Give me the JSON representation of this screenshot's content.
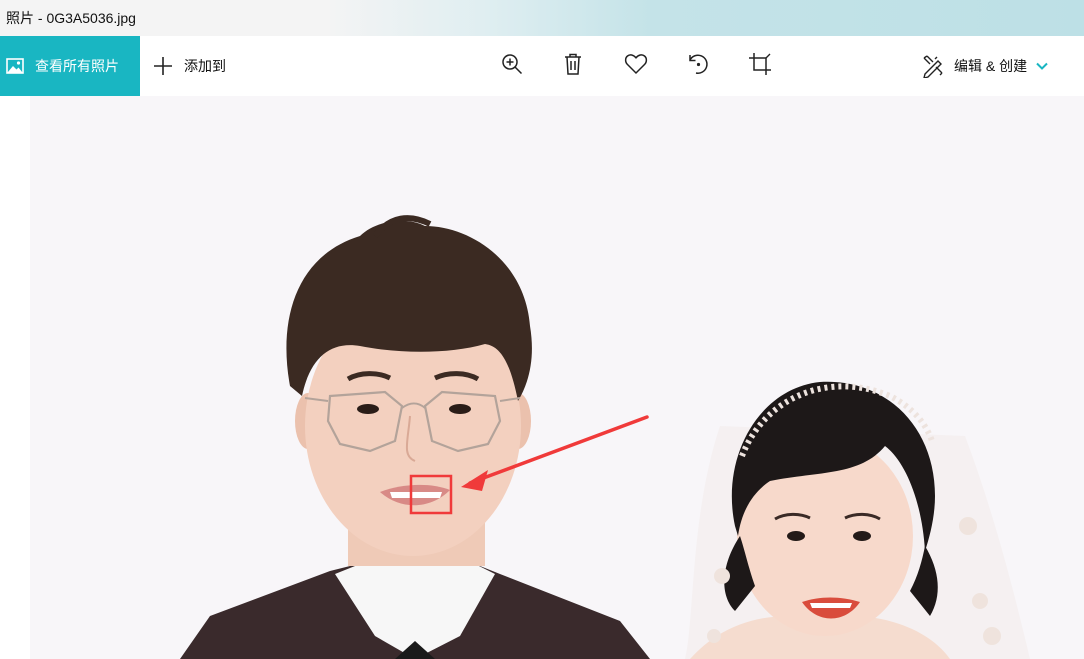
{
  "window": {
    "title": "照片 - 0G3A5036.jpg"
  },
  "toolbar": {
    "all_photos_label": "查看所有照片",
    "add_to_label": "添加到",
    "edit_create_label": "编辑 & 创建"
  },
  "colors": {
    "accent": "#19b6c2",
    "annotation": "#f03a3a"
  },
  "icons": [
    "photos-icon",
    "plus-icon",
    "zoom-in-icon",
    "trash-icon",
    "heart-icon",
    "rotate-icon",
    "crop-icon",
    "edit-create-icon",
    "chevron-down-icon"
  ]
}
